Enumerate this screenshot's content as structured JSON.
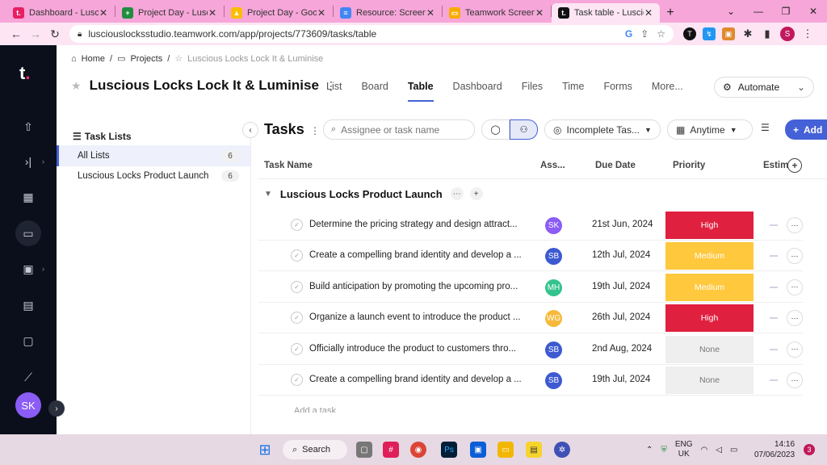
{
  "browser": {
    "tabs": [
      {
        "title": "Dashboard - Luscio",
        "fav_color": "#e91e63",
        "fav_glyph": "t."
      },
      {
        "title": "Project Day - Luscio",
        "fav_color": "#1e8e3e",
        "fav_glyph": "+"
      },
      {
        "title": "Project Day - Goog",
        "fav_color": "#fbbc04",
        "fav_glyph": "▲"
      },
      {
        "title": "Resource: Screen Sh",
        "fav_color": "#4285f4",
        "fav_glyph": "≡"
      },
      {
        "title": "Teamwork Screensh",
        "fav_color": "#f9ab00",
        "fav_glyph": "▭"
      },
      {
        "title": "Task table - Luscio",
        "fav_color": "#111111",
        "fav_glyph": "t."
      }
    ],
    "url": "lusciouslocksstudio.teamwork.com/app/projects/773609/tasks/table",
    "profile_initial": "S"
  },
  "rail": {
    "logo": "t",
    "avatar": "SK"
  },
  "header": {
    "breadcrumb": {
      "home": "Home",
      "projects": "Projects",
      "current": "Luscious Locks Lock It & Luminise"
    },
    "project_name": "Luscious Locks Lock It & Luminise",
    "view_tabs": [
      "List",
      "Board",
      "Table",
      "Dashboard",
      "Files",
      "Time",
      "Forms",
      "More..."
    ],
    "active_tab": "Table",
    "automate_label": "Automate"
  },
  "task_lists": {
    "heading": "Task Lists",
    "items": [
      {
        "label": "All Lists",
        "count": "6"
      },
      {
        "label": "Luscious Locks Product Launch",
        "count": "6"
      }
    ]
  },
  "toolbar": {
    "title": "Tasks",
    "search_placeholder": "Assignee or task name",
    "status_filter": "Incomplete Tas...",
    "date_filter": "Anytime",
    "add_label": "Add"
  },
  "table": {
    "columns": {
      "name": "Task Name",
      "assignee": "Ass...",
      "due": "Due Date",
      "priority": "Priority",
      "estimate": "Estim"
    },
    "group_name": "Luscious Locks Product Launch",
    "rows": [
      {
        "name": "Determine the pricing strategy and design attract...",
        "assignee": "SK",
        "assignee_color": "#8b5cf6",
        "due": "21st Jun, 2024",
        "priority": "High"
      },
      {
        "name": "Create a compelling brand identity and develop a ...",
        "assignee": "SB",
        "assignee_color": "#3d5ad1",
        "due": "12th Jul, 2024",
        "priority": "Medium"
      },
      {
        "name": "Build anticipation by promoting the upcoming pro...",
        "assignee": "MH",
        "assignee_color": "#34c38f",
        "due": "19th Jul, 2024",
        "priority": "Medium"
      },
      {
        "name": "Organize a launch event to introduce the product ...",
        "assignee": "WG",
        "assignee_color": "#f6b93b",
        "due": "26th Jul, 2024",
        "priority": "High"
      },
      {
        "name": "Officially introduce the product to customers thro...",
        "assignee": "SB",
        "assignee_color": "#3d5ad1",
        "due": "2nd Aug, 2024",
        "priority": "None"
      },
      {
        "name": "Create a compelling brand identity and develop a ...",
        "assignee": "SB",
        "assignee_color": "#3d5ad1",
        "due": "19th Jul, 2024",
        "priority": "None"
      }
    ],
    "priority_colors": {
      "High": {
        "bg": "#e0203f",
        "fg": "#ffffff"
      },
      "Medium": {
        "bg": "#ffc83d",
        "fg": "#ffffff"
      },
      "None": {
        "bg": "#efefef",
        "fg": "#777777"
      }
    },
    "add_task_label": "Add a task"
  },
  "taskbar": {
    "search_label": "Search",
    "lang_top": "ENG",
    "lang_bottom": "UK",
    "time": "14:16",
    "date": "07/06/2023",
    "notif_count": "3"
  }
}
